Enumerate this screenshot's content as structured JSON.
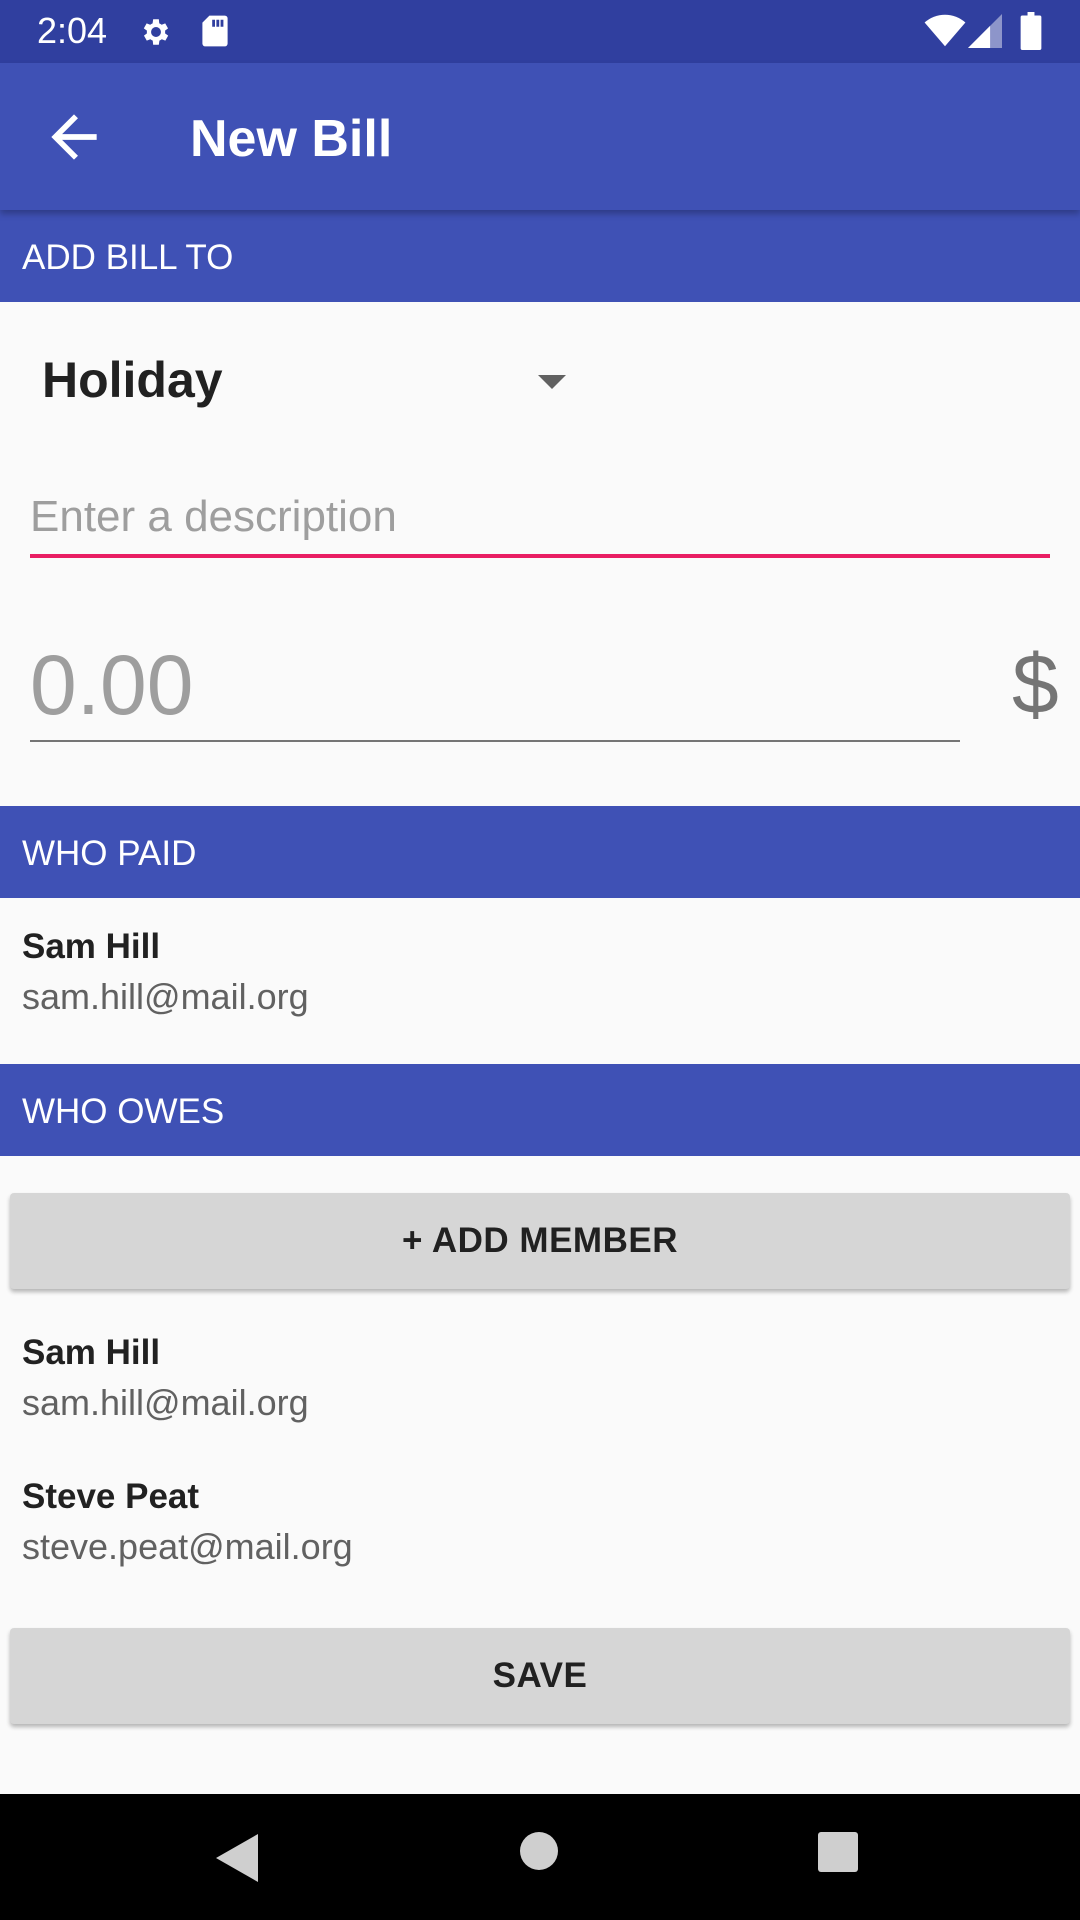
{
  "status_bar": {
    "time": "2:04"
  },
  "app_bar": {
    "title": "New Bill"
  },
  "add_bill_to": {
    "header": "ADD BILL TO",
    "selected_group": "Holiday"
  },
  "description": {
    "placeholder": "Enter a description",
    "value": ""
  },
  "amount": {
    "placeholder": "0.00",
    "value": "",
    "currency": "$"
  },
  "who_paid": {
    "header": "WHO PAID",
    "members": [
      {
        "name": "Sam Hill",
        "email": "sam.hill@mail.org"
      }
    ]
  },
  "who_owes": {
    "header": "WHO OWES",
    "add_member_label": "+ ADD MEMBER",
    "members": [
      {
        "name": "Sam Hill",
        "email": "sam.hill@mail.org"
      },
      {
        "name": "Steve Peat",
        "email": "steve.peat@mail.org"
      }
    ]
  },
  "save_label": "SAVE",
  "colors": {
    "status_bar": "#303f9f",
    "primary": "#3f51b5",
    "accent": "#e91e63",
    "button": "#d6d6d6",
    "background": "#fafafa"
  },
  "icons": [
    "settings-icon",
    "sd-card-icon",
    "wifi-icon",
    "signal-icon",
    "battery-icon",
    "back-arrow-icon",
    "dropdown-arrow-icon",
    "nav-back-icon",
    "nav-home-icon",
    "nav-recents-icon"
  ]
}
